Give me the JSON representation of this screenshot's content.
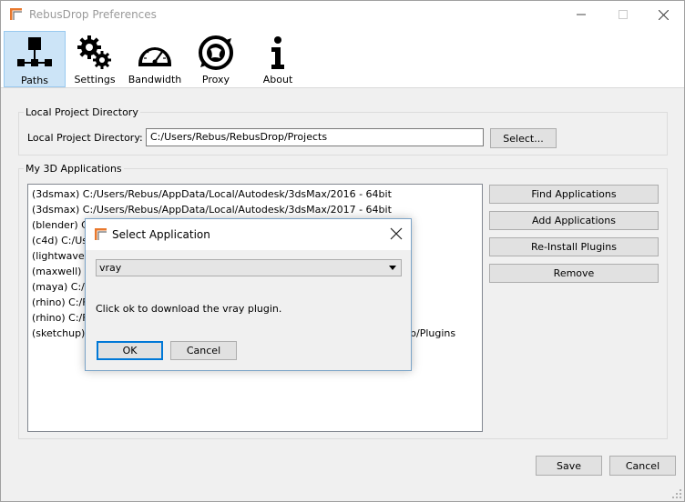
{
  "window": {
    "title": "RebusDrop Preferences"
  },
  "toolbar": {
    "items": [
      {
        "label": "Paths",
        "icon": "paths-icon",
        "active": true
      },
      {
        "label": "Settings",
        "icon": "gears-icon"
      },
      {
        "label": "Bandwidth",
        "icon": "gauge-icon"
      },
      {
        "label": "Proxy",
        "icon": "proxy-globe-icon"
      },
      {
        "label": "About",
        "icon": "info-icon"
      }
    ]
  },
  "local_project": {
    "group_title": "Local Project Directory",
    "label": "Local Project Directory:",
    "value": "C:/Users/Rebus/RebusDrop/Projects",
    "select_button": "Select..."
  },
  "applications": {
    "group_title": "My 3D Applications",
    "items": [
      "(3dsmax) C:/Users/Rebus/AppData/Local/Autodesk/3dsMax/2016 - 64bit",
      "(3dsmax) C:/Users/Rebus/AppData/Local/Autodesk/3dsMax/2017 - 64bit",
      "(blender) C:",
      "(c4d) C:/Us",
      "(lightwave)",
      "(maxwell) r",
      "(maya) C:/U",
      "(rhino) C:/F",
      "(rhino) C:/F",
      "(sketchup)"
    ],
    "sketchup_tail": "hUp/Plugins",
    "buttons": {
      "find": "Find Applications",
      "add": "Add Applications",
      "reinstall": "Re-Install Plugins",
      "remove": "Remove"
    }
  },
  "footer": {
    "save": "Save",
    "cancel": "Cancel"
  },
  "dialog": {
    "title": "Select Application",
    "selected": "vray",
    "message": "Click ok to download the vray plugin.",
    "ok": "OK",
    "cancel": "Cancel"
  },
  "colors": {
    "accent": "#0078d7",
    "selected_tab": "#cce4f7",
    "logo_orange": "#e8782d"
  }
}
